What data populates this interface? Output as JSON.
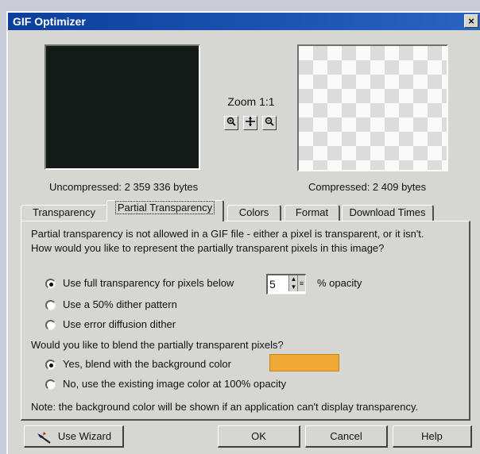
{
  "window": {
    "title": "GIF Optimizer",
    "close_glyph": "×"
  },
  "preview": {
    "uncompressed_label": "Uncompressed: 2 359 336 bytes",
    "compressed_label": "Compressed: 2 409 bytes",
    "zoom_label": "Zoom 1:1",
    "zoom_in_icon": "zoom-in-icon",
    "pan_icon": "pan-icon",
    "zoom_out_icon": "zoom-out-icon"
  },
  "tabs": [
    {
      "label": "Transparency",
      "active": false
    },
    {
      "label": "Partial Transparency",
      "active": true
    },
    {
      "label": "Colors",
      "active": false
    },
    {
      "label": "Format",
      "active": false
    },
    {
      "label": "Download Times",
      "active": false
    }
  ],
  "panel": {
    "intro_line1": "Partial transparency is not allowed in a GIF file - either a pixel is transparent, or it isn't.",
    "intro_line2": "How would you like to represent the partially transparent pixels in this image?",
    "options": [
      {
        "label": "Use full transparency for pixels below",
        "checked": true
      },
      {
        "label": "Use a 50% dither pattern",
        "checked": false
      },
      {
        "label": "Use error diffusion dither",
        "checked": false
      }
    ],
    "opacity_value": "5",
    "opacity_unit": "% opacity",
    "blend_question": "Would you like to blend the partially transparent pixels?",
    "blend_options": [
      {
        "label": "Yes, blend with the background color",
        "checked": true
      },
      {
        "label": "No, use the existing image color at 100% opacity",
        "checked": false
      }
    ],
    "background_color": "#f0a836",
    "note": "Note: the background color will be shown if an application can't display transparency."
  },
  "buttons": {
    "wizard": "Use Wizard",
    "ok": "OK",
    "cancel": "Cancel",
    "help": "Help"
  }
}
